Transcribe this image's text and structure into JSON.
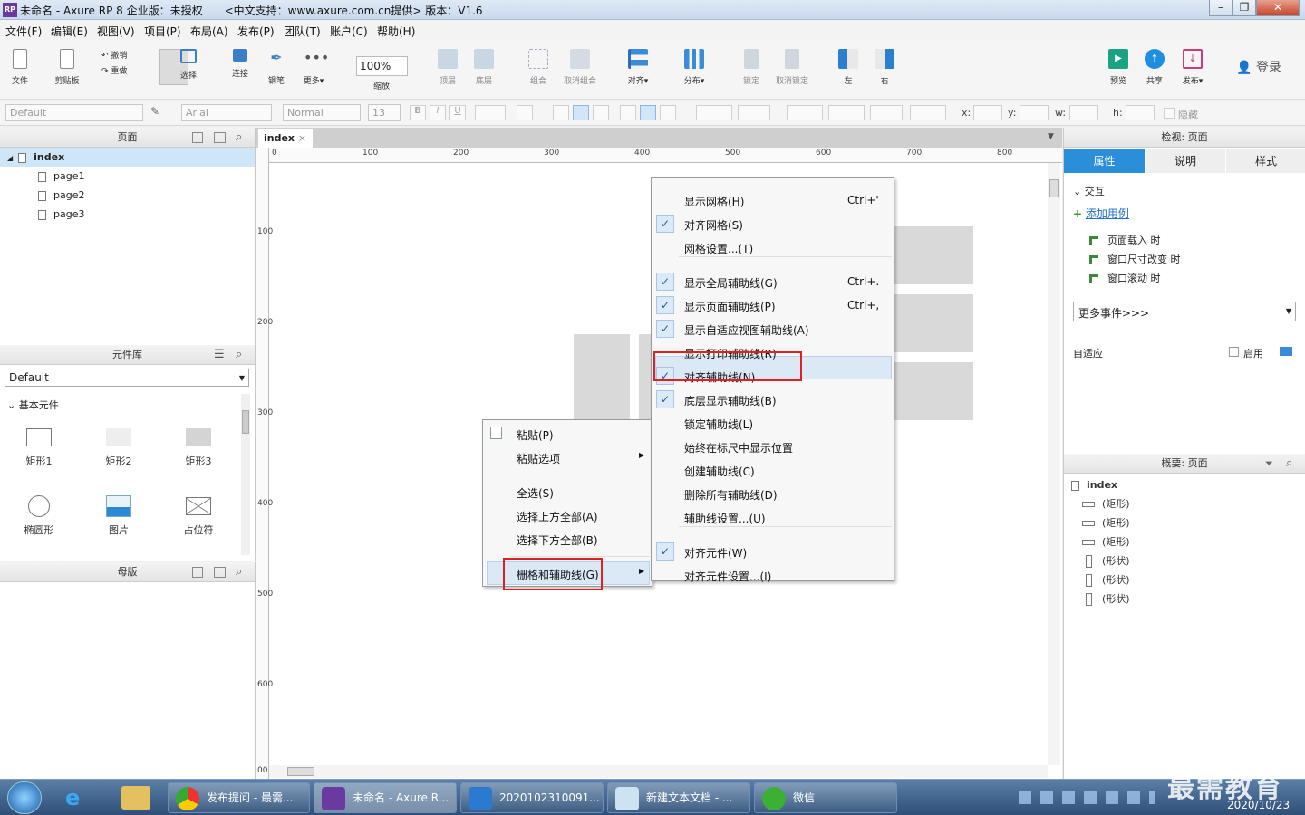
{
  "window": {
    "title": "未命名 - Axure RP 8 企业版：未授权　　<中文支持：www.axure.com.cn提供> 版本：V1.6",
    "logo": "RP"
  },
  "menubar": [
    "文件(F)",
    "编辑(E)",
    "视图(V)",
    "项目(P)",
    "布局(A)",
    "发布(P)",
    "团队(T)",
    "账户(C)",
    "帮助(H)"
  ],
  "toolbar": {
    "file": "文件",
    "clipboard": "剪贴板",
    "undo": "撤销",
    "redo": "重做",
    "select": "选择",
    "connect": "连接",
    "pen": "钢笔",
    "more": "更多▾",
    "zoom": "100%",
    "zoom_label": "缩放",
    "top": "顶层",
    "bottom": "底层",
    "group": "组合",
    "ungroup": "取消组合",
    "align": "对齐▾",
    "distribute": "分布▾",
    "lock": "锁定",
    "unlock": "取消锁定",
    "left": "左",
    "right": "右",
    "preview": "预览",
    "share": "共享",
    "publish": "发布▾",
    "login": "登录"
  },
  "formatbar": {
    "style": "Default",
    "font": "Arial",
    "weight": "Normal",
    "size": "13",
    "x": "x:",
    "y": "y:",
    "w": "w:",
    "h": "h:",
    "hide": "隐藏"
  },
  "pages_panel": {
    "title": "页面",
    "root": "index",
    "pages": [
      "page1",
      "page2",
      "page3"
    ]
  },
  "library_panel": {
    "title": "元件库",
    "library": "Default",
    "group": "基本元件",
    "items": [
      "矩形1",
      "矩形2",
      "矩形3",
      "椭圆形",
      "图片",
      "占位符"
    ]
  },
  "masters_panel": {
    "title": "母版"
  },
  "canvas": {
    "tab": "index",
    "ruler_top": [
      "0",
      "100",
      "200",
      "300",
      "400",
      "500",
      "600",
      "700",
      "800"
    ],
    "ruler_left": [
      "100",
      "200",
      "300",
      "400",
      "500",
      "600",
      "00"
    ]
  },
  "context_menu": {
    "items": [
      "粘贴(P)",
      "粘贴选项",
      "全选(S)",
      "选择上方全部(A)",
      "选择下方全部(B)",
      "栅格和辅助线(G)"
    ]
  },
  "submenu": {
    "items": [
      {
        "label": "显示网格(H)",
        "shortcut": "Ctrl+'",
        "checked": false
      },
      {
        "label": "对齐网格(S)",
        "shortcut": "",
        "checked": true
      },
      {
        "label": "网格设置...(T)",
        "shortcut": "",
        "checked": false
      },
      {
        "label": "显示全局辅助线(G)",
        "shortcut": "Ctrl+.",
        "checked": true
      },
      {
        "label": "显示页面辅助线(P)",
        "shortcut": "Ctrl+,",
        "checked": true
      },
      {
        "label": "显示自适应视图辅助线(A)",
        "shortcut": "",
        "checked": true
      },
      {
        "label": "显示打印辅助线(R)",
        "shortcut": "",
        "checked": false
      },
      {
        "label": "对齐辅助线(N)",
        "shortcut": "",
        "checked": true
      },
      {
        "label": "底层显示辅助线(B)",
        "shortcut": "",
        "checked": true
      },
      {
        "label": "锁定辅助线(L)",
        "shortcut": "",
        "checked": false
      },
      {
        "label": "始终在标尺中显示位置",
        "shortcut": "",
        "checked": false
      },
      {
        "label": "创建辅助线(C)",
        "shortcut": "",
        "checked": false
      },
      {
        "label": "删除所有辅助线(D)",
        "shortcut": "",
        "checked": false
      },
      {
        "label": "辅助线设置...(U)",
        "shortcut": "",
        "checked": false
      },
      {
        "label": "对齐元件(W)",
        "shortcut": "",
        "checked": true
      },
      {
        "label": "对齐元件设置...(I)",
        "shortcut": "",
        "checked": false
      }
    ]
  },
  "inspector": {
    "title": "检视: 页面",
    "tabs": [
      "属性",
      "说明",
      "样式"
    ],
    "interaction": "交互",
    "add_case": "添加用例",
    "events": [
      "页面载入 时",
      "窗口尺寸改变 时",
      "窗口滚动 时"
    ],
    "more_events": "更多事件>>>",
    "adaptive": "自适应",
    "enable": "启用"
  },
  "outline": {
    "title": "概要: 页面",
    "root": "index",
    "items": [
      "(矩形)",
      "(矩形)",
      "(矩形)",
      "(形状)",
      "(形状)",
      "(形状)"
    ]
  },
  "taskbar": {
    "tasks": [
      "发布提问 - 最需...",
      "未命名 - Axure R...",
      "2020102310091...",
      "新建文本文档 - ...",
      "微信"
    ],
    "date": "2020/10/23",
    "watermark": "最需教育"
  },
  "colors": {
    "accent": "#3399dd",
    "highlight": "#e02020"
  }
}
